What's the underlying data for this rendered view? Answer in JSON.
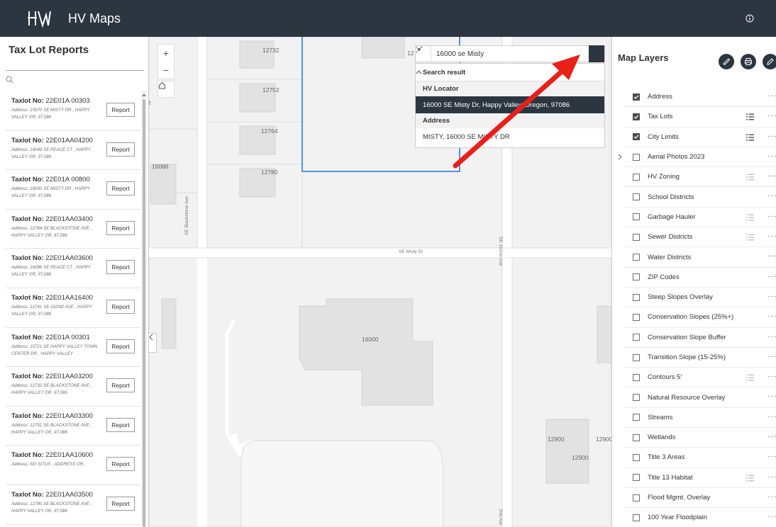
{
  "header": {
    "title": "HV Maps",
    "logo_text": "HV"
  },
  "left_panel": {
    "title": "Tax Lot Reports",
    "search_placeholder": "",
    "lots": [
      {
        "label": "Taxlot No:",
        "id": "22E01A 00303",
        "address": "Address: 15970 SE MISTY DR , HAPPY VALLEY OR, 97,086",
        "button": "Report"
      },
      {
        "label": "Taxlot No:",
        "id": "22E01AA04200",
        "address": "Address: 16049 SE PEACE CT , HAPPY VALLEY OR, 97,086",
        "button": "Report"
      },
      {
        "label": "Taxlot No:",
        "id": "22E01A 00800",
        "address": "Address: 16000 SE MISTY DR , HAPPY VALLEY OR, 97,086",
        "button": "Report"
      },
      {
        "label": "Taxlot No:",
        "id": "22E01AA03400",
        "address": "Address: 12764 SE BLACKSTONE AVE , HAPPY VALLEY OR, 97,086",
        "button": "Report"
      },
      {
        "label": "Taxlot No:",
        "id": "22E01AA03600",
        "address": "Address: 16086 SE PEACE CT , HAPPY VALLEY OR, 97,086",
        "button": "Report"
      },
      {
        "label": "Taxlot No:",
        "id": "22E01AA16400",
        "address": "Address: 12741 SE 162ND AVE , HAPPY VALLEY OR, 97,086",
        "button": "Report"
      },
      {
        "label": "Taxlot No:",
        "id": "22E01A 00301",
        "address": "Address: 15721 SE HAPPY VALLEY TOWN CENTER DR , HAPPY VALLEY",
        "button": "Report"
      },
      {
        "label": "Taxlot No:",
        "id": "22E01AA03200",
        "address": "Address: 12732 SE BLACKSTONE AVE , HAPPY VALLEY OR, 97,086",
        "button": "Report"
      },
      {
        "label": "Taxlot No:",
        "id": "22E01AA03300",
        "address": "Address: 12752 SE BLACKSTONE AVE , HAPPY VALLEY OR, 97,086",
        "button": "Report"
      },
      {
        "label": "Taxlot No:",
        "id": "22E01AA10600",
        "address": "Address: NO SITUS , ADDRESS OR,",
        "button": "Report"
      },
      {
        "label": "Taxlot No:",
        "id": "22E01AA03500",
        "address": "Address: 12780 SE BLACKSTONE AVE , HAPPY VALLEY OR, 97,086",
        "button": "Report"
      }
    ]
  },
  "map": {
    "zoom_in": "+",
    "zoom_out": "−",
    "labels": {
      "p12732": "12732",
      "p12752": "12752",
      "p12764": "12764",
      "p12780": "12780",
      "p16086": "16086",
      "p16000": "16000",
      "p12900a": "12900",
      "p12900b": "12900",
      "p12900c": "12900",
      "p12t": "12",
      "t": "t"
    },
    "streets": {
      "misty": "SE Misty Dr",
      "blackstone": "SE Blackstone Ave",
      "s162": "SE 162nd Ave",
      "s162b": "2nd Ave"
    },
    "search": {
      "value": "16000 se Misty",
      "results_header": "Search result",
      "groups": [
        {
          "name": "HV Locator",
          "items": [
            "16000 SE Misty Dr, Happy Valley, Oregon, 97086"
          ]
        },
        {
          "name": "Address",
          "items": [
            "MISTY, 16000 SE MISTY DR"
          ]
        }
      ]
    }
  },
  "right_panel": {
    "title": "Map Layers",
    "layers": [
      {
        "name": "Address",
        "checked": true,
        "legend": false,
        "expand": false
      },
      {
        "name": "Tax Lots",
        "checked": true,
        "legend": true,
        "expand": false
      },
      {
        "name": "City Limits",
        "checked": true,
        "legend": true,
        "expand": false
      },
      {
        "name": "Aerial Photos 2023",
        "checked": false,
        "legend": false,
        "expand": true
      },
      {
        "name": "HV Zoning",
        "checked": false,
        "legend": "dim",
        "expand": false
      },
      {
        "name": "School Districts",
        "checked": false,
        "legend": false,
        "expand": false
      },
      {
        "name": "Garbage Hauler",
        "checked": false,
        "legend": "dim",
        "expand": false
      },
      {
        "name": "Sewer Districts",
        "checked": false,
        "legend": "dim",
        "expand": false
      },
      {
        "name": "Water Districts",
        "checked": false,
        "legend": false,
        "expand": false
      },
      {
        "name": "ZIP Codes",
        "checked": false,
        "legend": false,
        "expand": false
      },
      {
        "name": "Steep Slopes Overlay",
        "checked": false,
        "legend": false,
        "expand": false
      },
      {
        "name": "Conservation Slopes (25%+)",
        "checked": false,
        "legend": false,
        "expand": false
      },
      {
        "name": "Conservation Slope Buffer",
        "checked": false,
        "legend": false,
        "expand": false
      },
      {
        "name": "Transition Slope (15-25%)",
        "checked": false,
        "legend": false,
        "expand": false
      },
      {
        "name": "Contours 5'",
        "checked": false,
        "legend": "dim",
        "expand": false
      },
      {
        "name": "Natural Resource Overlay",
        "checked": false,
        "legend": false,
        "expand": false
      },
      {
        "name": "Streams",
        "checked": false,
        "legend": false,
        "expand": false
      },
      {
        "name": "Wetlands",
        "checked": false,
        "legend": false,
        "expand": false
      },
      {
        "name": "Title 3 Areas",
        "checked": false,
        "legend": false,
        "expand": false
      },
      {
        "name": "Title 13 Habitat",
        "checked": false,
        "legend": "dim",
        "expand": false
      },
      {
        "name": "Flood Mgmt. Overlay",
        "checked": false,
        "legend": false,
        "expand": false
      },
      {
        "name": "100 Year Floodplain",
        "checked": false,
        "legend": false,
        "expand": false
      }
    ],
    "more_glyph": "···"
  },
  "colors": {
    "header": "#2c3640",
    "arrow": "#e8201a",
    "selection": "#1f6fe0"
  }
}
